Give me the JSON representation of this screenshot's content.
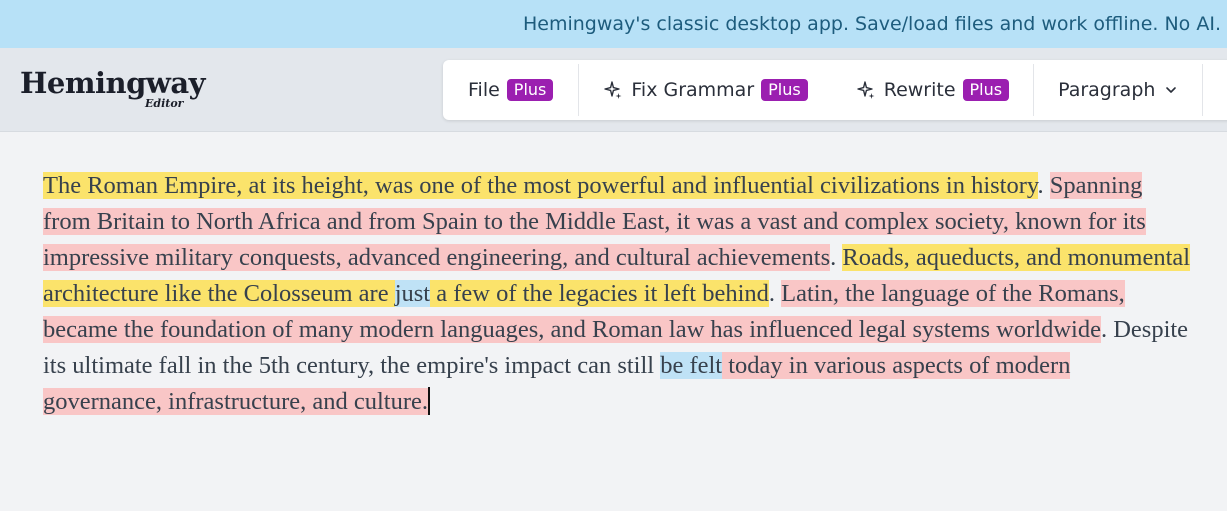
{
  "banner": {
    "text": "Hemingway's classic desktop app. Save/load files and work offline. No AI."
  },
  "logo": {
    "title": "Hemingway",
    "subtitle": "Editor"
  },
  "toolbar": {
    "file_label": "File",
    "fix_grammar_label": "Fix Grammar",
    "rewrite_label": "Rewrite",
    "paragraph_label": "Paragraph",
    "plus_badge": "Plus"
  },
  "colors": {
    "banner_bg": "#b7e1f7",
    "badge_bg": "#9b1fb0",
    "hard_sentence": "#fbe36b",
    "very_hard_sentence": "#f9c6c6",
    "passive_voice": "#bfe2f6"
  },
  "document": {
    "s1": "The Roman Empire, at its height, was one of the most powerful and influential civilizations in history",
    "p1": ". ",
    "s2": "Spanning from Britain to North Africa and from Spain to the Middle East, it was a vast and complex society, known for its impressive military conquests, advanced engineering, and cultural achievements",
    "p2": ". ",
    "s3a": "Roads, aqueducts, and monumental architecture like the Colosseum are",
    "sp3": " ",
    "s3b": "just",
    "sp4": " ",
    "s3c": "a few of the legacies it left behind",
    "p3": ". ",
    "s4": "Latin, the language of the Romans, became the foundation of many modern languages, and Roman law has influenced legal systems worldwide",
    "p4": ". ",
    "s5a": "Despite its ultimate fall in the 5th century, the empire's impact can still ",
    "s5b": "be felt",
    "sp5": " ",
    "s5c": "today in various aspects of modern governance, infrastructure, and culture",
    "p5": "."
  }
}
